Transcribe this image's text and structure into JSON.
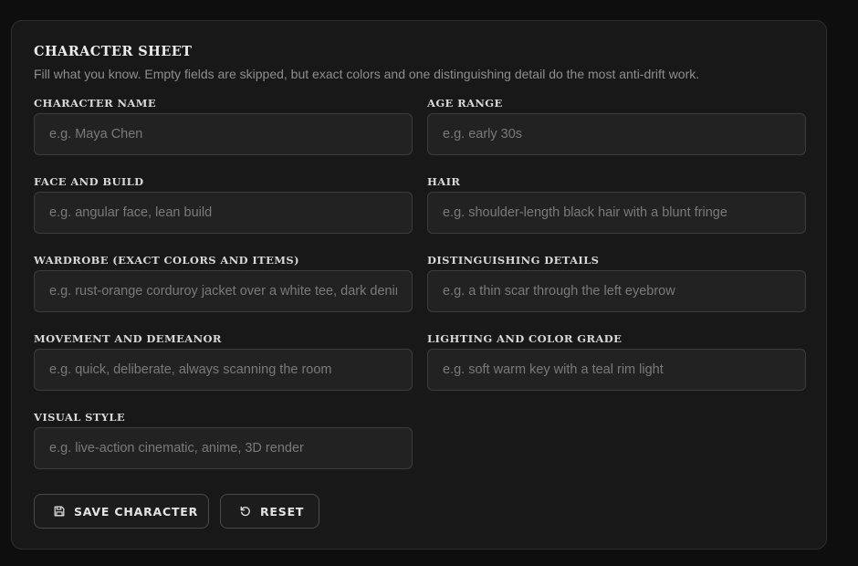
{
  "form": {
    "title": "CHARACTER SHEET",
    "subtitle": "Fill what you know. Empty fields are skipped, but exact colors and one distinguishing detail do the most anti-drift work."
  },
  "fields": {
    "character_name": {
      "label": "CHARACTER NAME",
      "value": "",
      "placeholder": "e.g. Maya Chen"
    },
    "age_range": {
      "label": "AGE RANGE",
      "value": "",
      "placeholder": "e.g. early 30s"
    },
    "face_build": {
      "label": "FACE AND BUILD",
      "value": "",
      "placeholder": "e.g. angular face, lean build"
    },
    "hair": {
      "label": "HAIR",
      "value": "",
      "placeholder": "e.g. shoulder-length black hair with a blunt fringe"
    },
    "wardrobe": {
      "label": "WARDROBE (EXACT COLORS AND ITEMS)",
      "value": "",
      "placeholder": "e.g. rust-orange corduroy jacket over a white tee, dark denim"
    },
    "distinguishing": {
      "label": "DISTINGUISHING DETAILS",
      "value": "",
      "placeholder": "e.g. a thin scar through the left eyebrow"
    },
    "movement": {
      "label": "MOVEMENT AND DEMEANOR",
      "value": "",
      "placeholder": "e.g. quick, deliberate, always scanning the room"
    },
    "lighting": {
      "label": "LIGHTING AND COLOR GRADE",
      "value": "",
      "placeholder": "e.g. soft warm key with a teal rim light"
    },
    "visual_style": {
      "label": "VISUAL STYLE",
      "value": "",
      "placeholder": "e.g. live-action cinematic, anime, 3D render"
    }
  },
  "buttons": {
    "save": {
      "label": "SAVE CHARACTER",
      "icon": "save-icon"
    },
    "reset": {
      "label": "RESET",
      "icon": "reset-icon"
    }
  },
  "colors": {
    "background": "#0e0e0e",
    "card": "#181818",
    "input": "#222222",
    "border": "#3c3c3c",
    "text": "#ececec",
    "muted": "#8e8e8e"
  }
}
